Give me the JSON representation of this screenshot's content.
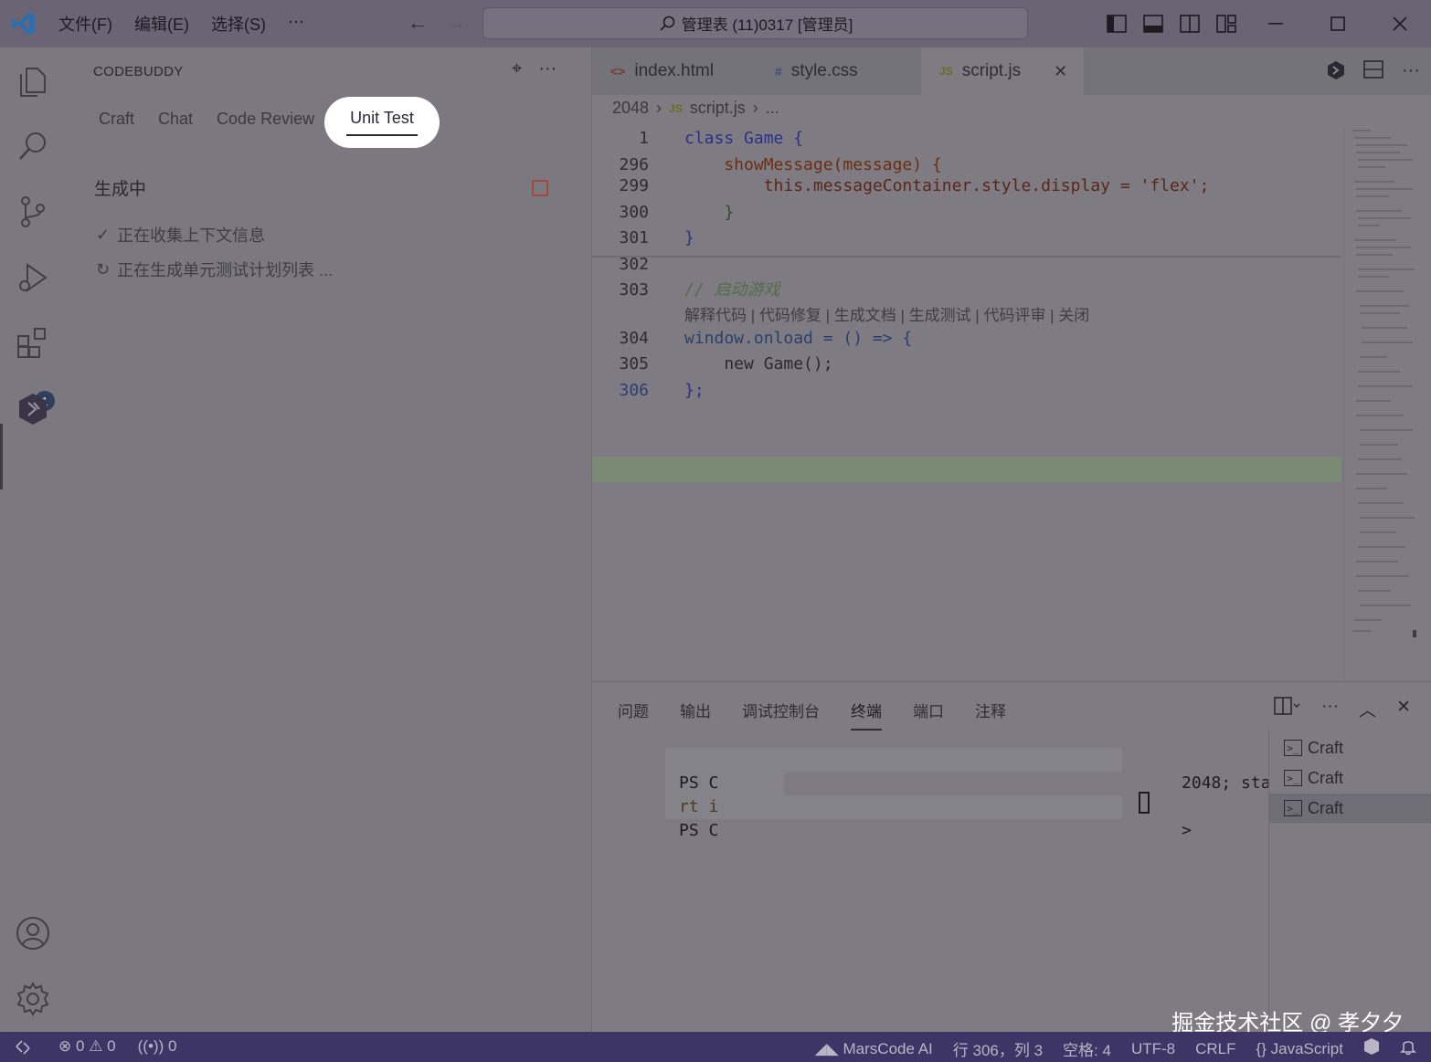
{
  "titlebar": {
    "menu": [
      "文件(F)",
      "编辑(E)",
      "选择(S)",
      "···"
    ],
    "search_text": "管理表 (11)0317 [管理员]"
  },
  "sidebar": {
    "title": "CODEBUDDY",
    "tabs": [
      "Craft",
      "Chat",
      "Code Review"
    ],
    "active_tab": "Unit Test",
    "status": "生成中",
    "steps": [
      {
        "icon": "check-icon",
        "glyph": "✓",
        "text": "正在收集上下文信息"
      },
      {
        "icon": "refresh-icon",
        "glyph": "↻",
        "text": "正在生成单元测试计划列表 ..."
      }
    ],
    "activity_badge": "1"
  },
  "editor": {
    "tabs": [
      {
        "icon": "<>",
        "label": "index.html"
      },
      {
        "icon": "#",
        "label": "style.css"
      },
      {
        "icon": "JS",
        "label": "script.js"
      }
    ],
    "breadcrumb": [
      "2048",
      "script.js",
      "..."
    ],
    "breadcrumb_icon": "JS",
    "codelens": "解释代码 | 代码修复 | 生成文档 | 生成测试 | 代码评审 | 关闭",
    "lines": [
      {
        "n": "1",
        "t": "class Game {"
      },
      {
        "n": "296",
        "t": "    showMessage(message) {"
      },
      {
        "n": "299",
        "t": "        this.messageContainer.style.display = 'flex';"
      },
      {
        "n": "300",
        "t": "    }"
      },
      {
        "n": "301",
        "t": "}"
      },
      {
        "n": "302",
        "t": ""
      },
      {
        "n": "303",
        "t": "// 启动游戏"
      },
      {
        "n": "304",
        "t": "window.onload = () => {"
      },
      {
        "n": "305",
        "t": "    new Game();"
      },
      {
        "n": "306",
        "t": "};"
      }
    ]
  },
  "panel": {
    "tabs": [
      "问题",
      "输出",
      "调试控制台",
      "终端",
      "端口",
      "注释"
    ],
    "active_tab": "终端",
    "terminal": {
      "line1_start": "PS C",
      "line1_end": "2048; sta",
      "line2_start": "rt i",
      "line3_start": "PS C",
      "line3_end": ">"
    },
    "terminals": [
      "Craft",
      "Craft",
      "Craft"
    ]
  },
  "watermark": "掘金技术社区 @ 孝夕夕",
  "statusbar": {
    "errors": "0",
    "warnings": "0",
    "ports": "0",
    "marscode": "MarsCode AI",
    "position": "行 306，列 3",
    "spaces": "空格: 4",
    "encoding": "UTF-8",
    "eol": "CRLF",
    "language": "JavaScript"
  },
  "colors": {
    "accent": "#3d3565",
    "codebuddy": "#6b5aa8",
    "vscode_blue": "#2a6fb0"
  }
}
